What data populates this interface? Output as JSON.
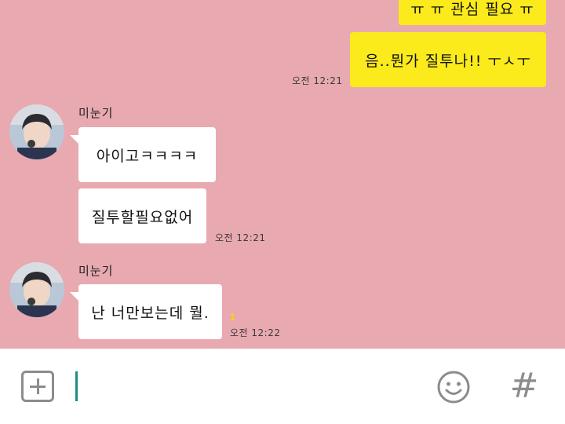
{
  "messages": {
    "mine_partial": "ㅠ ㅠ 관심 필요 ㅠ",
    "mine_1": "음..뭔가 질투나!! ㅜㅅㅜ",
    "mine_1_time": "오전 12:21",
    "group_1": {
      "sender": "미눈기",
      "bubble_1": "아이고ㅋㅋㅋㅋ",
      "bubble_2": "질투할필요없어",
      "time": "오전 12:21"
    },
    "group_2": {
      "sender": "미눈기",
      "bubble_1": "난 너만보는데 뭘.",
      "unread": "1",
      "time": "오전 12:22"
    }
  },
  "input": {
    "plus_icon": "plus-icon",
    "emoji_icon": "smiley-icon",
    "hash_label": "#"
  },
  "colors": {
    "chat_bg": "#e8a9b0",
    "my_bubble": "#fbea1c",
    "their_bubble": "#ffffff",
    "cursor": "#1a8f86"
  }
}
